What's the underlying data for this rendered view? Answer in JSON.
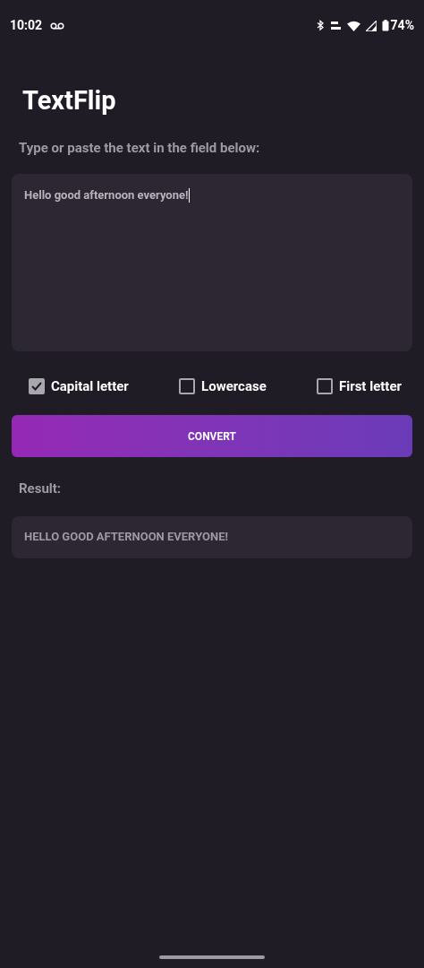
{
  "status_bar": {
    "time": "10:02",
    "battery": "74%"
  },
  "app": {
    "title": "TextFlip"
  },
  "input": {
    "label": "Type or paste the text in the field below:",
    "value": "Hello good afternoon everyone!"
  },
  "options": [
    {
      "label": "Capital letter",
      "checked": true
    },
    {
      "label": "Lowercase",
      "checked": false
    },
    {
      "label": "First letter",
      "checked": false
    }
  ],
  "convert_button": "CONVERT",
  "result": {
    "label": "Result:",
    "value": "HELLO GOOD AFTERNOON EVERYONE!"
  }
}
